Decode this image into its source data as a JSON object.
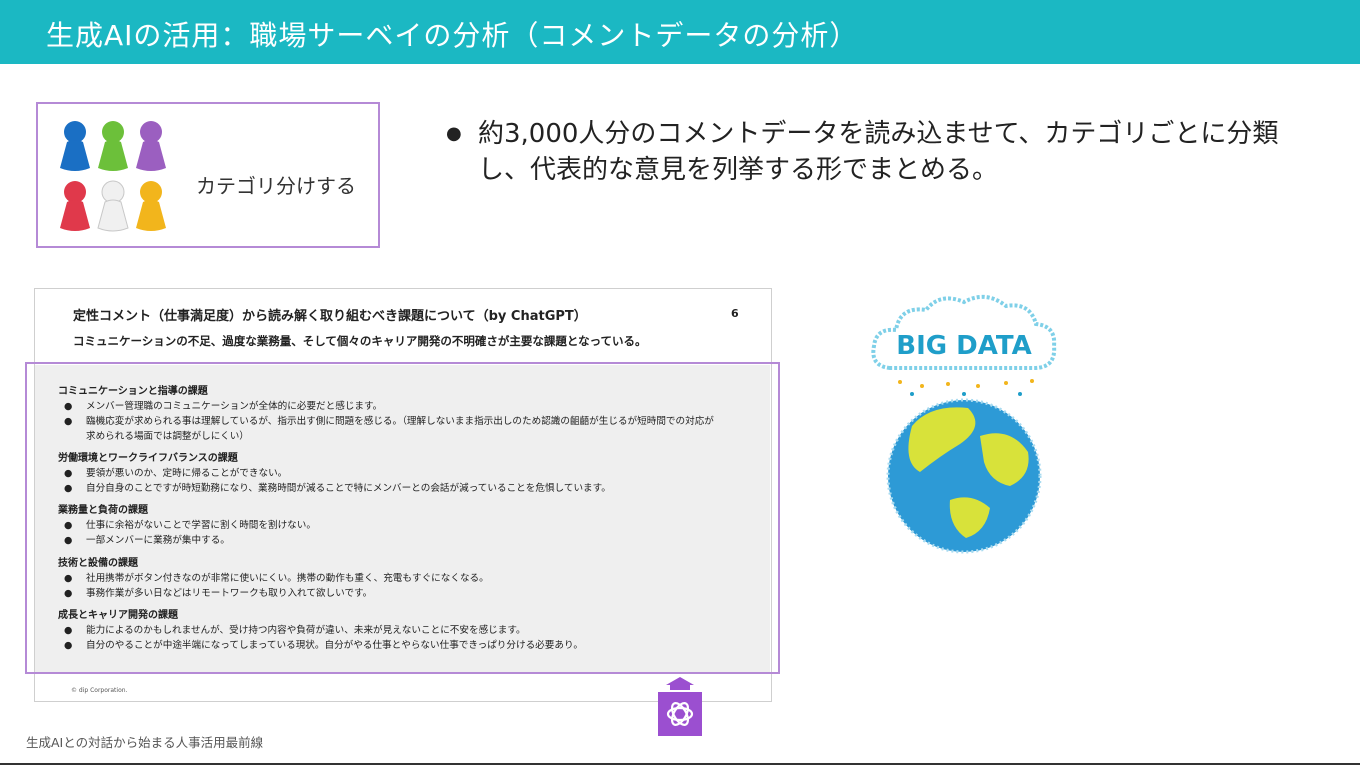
{
  "header": {
    "title": "生成AIの活用：職場サーベイの分析（コメントデータの分析）",
    "bg_color": "#1bb8c3"
  },
  "category_box": {
    "label": "カテゴリ分けする",
    "pawn_colors": [
      "#1a6fc4",
      "#6cc03a",
      "#9b5fc0",
      "#e0394b",
      "#f0f0f0",
      "#f2b51c"
    ]
  },
  "bullet": {
    "marker": "●",
    "text": "約3,000人分のコメントデータを読み込ませて、カテゴリごとに分類し、代表的な意見を列挙する形でまとめる。"
  },
  "slide": {
    "title": "定性コメント（仕事満足度）から読み解く取り組むべき課題について（by ChatGPT）",
    "page_number": "6",
    "subtitle": "コミュニケーションの不足、過度な業務量、そして個々のキャリア開発の不明確さが主要な課題となっている。",
    "footer": "© dip Corporation.",
    "sections": [
      {
        "heading": "コミュニケーションと指導の課題",
        "items": [
          "メンバー管理職のコミュニケーションが全体的に必要だと感じます。",
          "臨機応変が求められる事は理解しているが、指示出す側に問題を感じる。（理解しないまま指示出しのため認識の齟齬が生じるが短時間での対応が求められる場面では調整がしにくい）"
        ]
      },
      {
        "heading": "労働環境とワークライフバランスの課題",
        "items": [
          "要領が悪いのか、定時に帰ることができない。",
          "自分自身のことですが時短勤務になり、業務時間が減ることで特にメンバーとの会話が減っていることを危惧しています。"
        ]
      },
      {
        "heading": "業務量と負荷の課題",
        "items": [
          "仕事に余裕がないことで学習に割く時間を割けない。",
          "一部メンバーに業務が集中する。"
        ]
      },
      {
        "heading": "技術と設備の課題",
        "items": [
          "社用携帯がボタン付きなのが非常に使いにくい。携帯の動作も重く、充電もすぐになくなる。",
          "事務作業が多い日などはリモートワークも取り入れて欲しいです。"
        ]
      },
      {
        "heading": "成長とキャリア開発の課題",
        "items": [
          "能力によるのかもしれませんが、受け持つ内容や負荷が違い、未来が見えないことに不安を感じます。",
          "自分のやることが中途半端になってしまっている現状。自分がやる仕事とやらない仕事できっぱり分ける必要あり。"
        ]
      }
    ]
  },
  "big_data_label": "BIG DATA",
  "footer": {
    "text": "生成AIとの対話から始まる人事活用最前線"
  },
  "accent_color": "#9b4fd0"
}
